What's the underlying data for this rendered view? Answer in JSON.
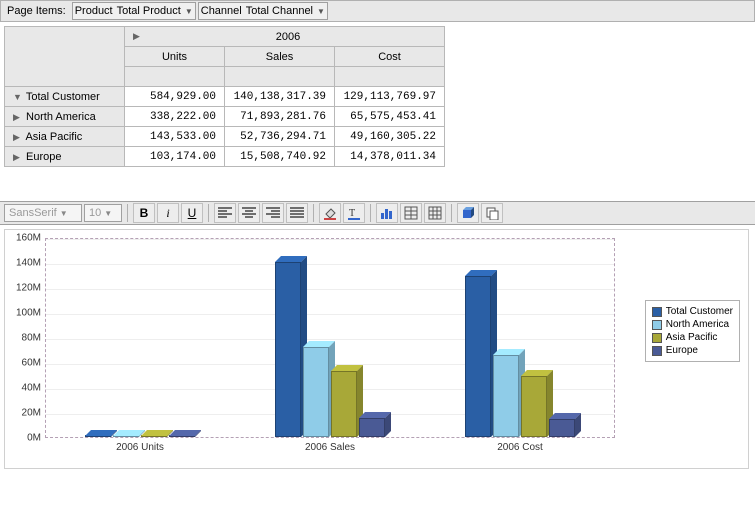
{
  "page_items": {
    "label": "Page Items:",
    "dims": [
      {
        "name": "Product",
        "value": "Total Product"
      },
      {
        "name": "Channel",
        "value": "Total Channel"
      }
    ]
  },
  "pivot": {
    "year": "2006",
    "columns": [
      "Units",
      "Sales",
      "Cost"
    ],
    "rows": [
      {
        "label": "Total Customer",
        "expandable": "collapse",
        "values": [
          "584,929.00",
          "140,138,317.39",
          "129,113,769.97"
        ]
      },
      {
        "label": "North America",
        "expandable": "expand",
        "values": [
          "338,222.00",
          "71,893,281.76",
          "65,575,453.41"
        ]
      },
      {
        "label": "Asia Pacific",
        "expandable": "expand",
        "values": [
          "143,533.00",
          "52,736,294.71",
          "49,160,305.22"
        ]
      },
      {
        "label": "Europe",
        "expandable": "expand",
        "values": [
          "103,174.00",
          "15,508,740.92",
          "14,378,011.34"
        ]
      }
    ]
  },
  "toolbar": {
    "font_name": "SansSerif",
    "font_size": "10",
    "buttons": {
      "bold": "B",
      "italic": "i",
      "underline": "U",
      "align_left": "≡",
      "align_center": "≡",
      "align_right": "≡",
      "align_justify": "≡"
    }
  },
  "colors": {
    "series": [
      "#2a5fa5",
      "#8fcce8",
      "#a8a838",
      "#4a5a95"
    ]
  },
  "chart_data": {
    "type": "bar",
    "title": "",
    "xlabel": "",
    "ylabel": "",
    "ylim": [
      0,
      160000000
    ],
    "y_ticks": [
      "0M",
      "20M",
      "40M",
      "60M",
      "80M",
      "100M",
      "120M",
      "140M",
      "160M"
    ],
    "categories": [
      "2006 Units",
      "2006 Sales",
      "2006 Cost"
    ],
    "series": [
      {
        "name": "Total Customer",
        "values": [
          584929,
          140138317,
          129113770
        ]
      },
      {
        "name": "North America",
        "values": [
          338222,
          71893282,
          65575453
        ]
      },
      {
        "name": "Asia Pacific",
        "values": [
          143533,
          52736295,
          49160305
        ]
      },
      {
        "name": "Europe",
        "values": [
          103174,
          15508741,
          14378011
        ]
      }
    ],
    "legend_position": "right"
  }
}
